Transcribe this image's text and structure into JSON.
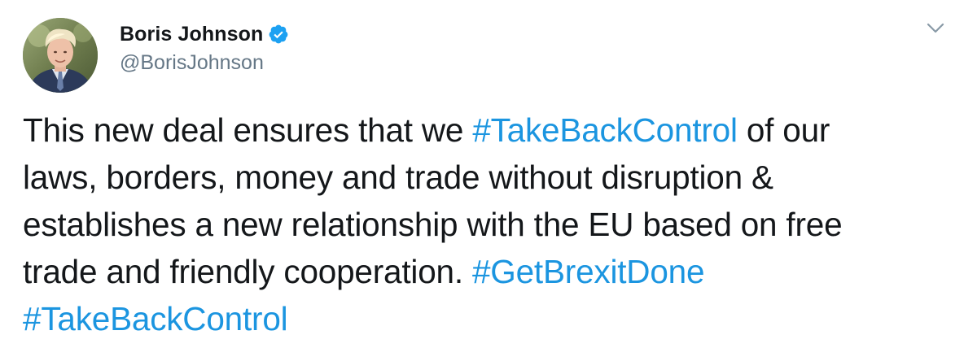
{
  "tweet": {
    "display_name": "Boris Johnson",
    "handle": "@BorisJohnson",
    "verified": true,
    "colors": {
      "text": "#14171a",
      "secondary": "#657786",
      "link": "#1b95e0",
      "verified_badge": "#1da1f2"
    },
    "icons": {
      "verified": "verified-badge-icon",
      "menu": "chevron-down-icon"
    },
    "text_lines": [
      [
        {
          "text": "This new deal ensures that we ",
          "hashtag": false
        },
        {
          "text": "#TakeBackControl",
          "hashtag": true
        },
        {
          "text": " of our",
          "hashtag": false
        }
      ],
      [
        {
          "text": "laws, borders, money and trade without disruption &",
          "hashtag": false
        }
      ],
      [
        {
          "text": "establishes a new relationship with the EU based on free",
          "hashtag": false
        }
      ],
      [
        {
          "text": "trade and friendly cooperation. ",
          "hashtag": false
        },
        {
          "text": "#GetBrexitDone",
          "hashtag": true
        }
      ],
      [
        {
          "text": "#TakeBackControl",
          "hashtag": true
        }
      ]
    ]
  }
}
